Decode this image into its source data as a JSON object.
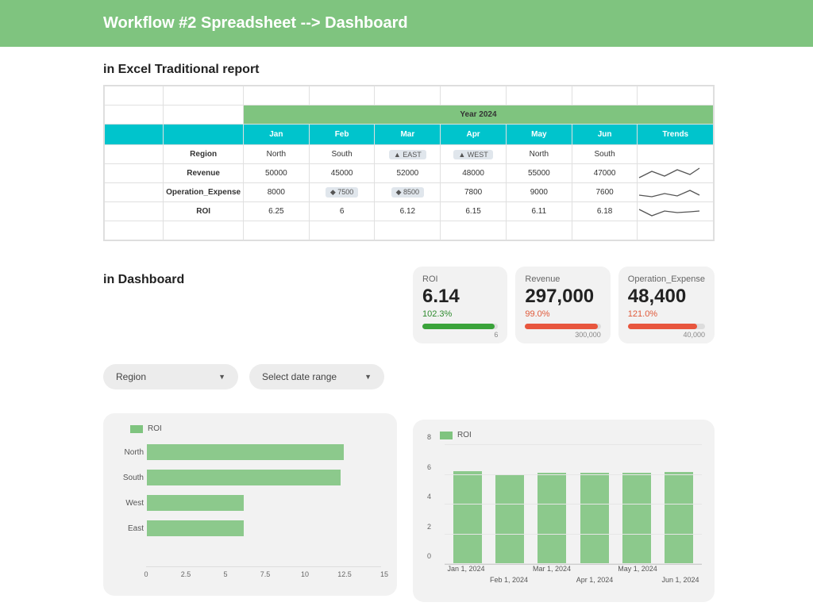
{
  "header": {
    "title": "Workflow #2 Spreadsheet --> Dashboard"
  },
  "section1": {
    "title": "in Excel Traditional report"
  },
  "section2": {
    "title": "in Dashboard"
  },
  "sheet": {
    "year_header": "Year 2024",
    "months": [
      "Jan",
      "Feb",
      "Mar",
      "Apr",
      "May",
      "Jun"
    ],
    "trends_header": "Trends",
    "rows": {
      "region_label": "Region",
      "region": [
        "North",
        "South",
        "EAST",
        "WEST",
        "North",
        "South"
      ],
      "region_pills": [
        false,
        false,
        true,
        true,
        false,
        false
      ],
      "revenue_label": "Revenue",
      "revenue": [
        "50000",
        "45000",
        "52000",
        "48000",
        "55000",
        "47000"
      ],
      "opex_label": "Operation_Expense",
      "opex": [
        "8000",
        "7500",
        "8500",
        "7800",
        "9000",
        "7600"
      ],
      "opex_pills": [
        false,
        true,
        true,
        false,
        false,
        false
      ],
      "roi_label": "ROI",
      "roi": [
        "6.25",
        "6",
        "6.12",
        "6.15",
        "6.11",
        "6.18"
      ]
    }
  },
  "filters": {
    "region_label": "Region",
    "date_label": "Select date range"
  },
  "kpis": [
    {
      "label": "ROI",
      "value": "6.14",
      "pct": "102.3%",
      "pct_class": "pct-green",
      "fill_class": "bf-green",
      "fill_pct": 95,
      "target": "6"
    },
    {
      "label": "Revenue",
      "value": "297,000",
      "pct": "99.0%",
      "pct_class": "pct-red",
      "fill_class": "bf-red",
      "fill_pct": 96,
      "target": "300,000"
    },
    {
      "label": "Operation_Expense",
      "value": "48,400",
      "pct": "121.0%",
      "pct_class": "pct-red",
      "fill_class": "bf-red",
      "fill_pct": 90,
      "target": "40,000"
    }
  ],
  "chart_data": [
    {
      "type": "bar",
      "orientation": "horizontal",
      "title": "",
      "legend": "ROI",
      "categories": [
        "North",
        "South",
        "West",
        "East"
      ],
      "values": [
        12.4,
        12.2,
        6.1,
        6.1
      ],
      "xlim": [
        0,
        15
      ],
      "xticks": [
        0,
        2.5,
        5,
        7.5,
        10,
        12.5,
        15
      ],
      "xlabel": "",
      "ylabel": ""
    },
    {
      "type": "bar",
      "orientation": "vertical",
      "title": "",
      "legend": "ROI",
      "categories": [
        "Jan 1, 2024",
        "Feb 1, 2024",
        "Mar 1, 2024",
        "Apr 1, 2024",
        "May 1, 2024",
        "Jun 1, 2024"
      ],
      "values": [
        6.25,
        6.0,
        6.12,
        6.15,
        6.11,
        6.18
      ],
      "ylim": [
        0,
        8
      ],
      "yticks": [
        0,
        2,
        4,
        6,
        8
      ],
      "xlabel": "",
      "ylabel": ""
    }
  ]
}
